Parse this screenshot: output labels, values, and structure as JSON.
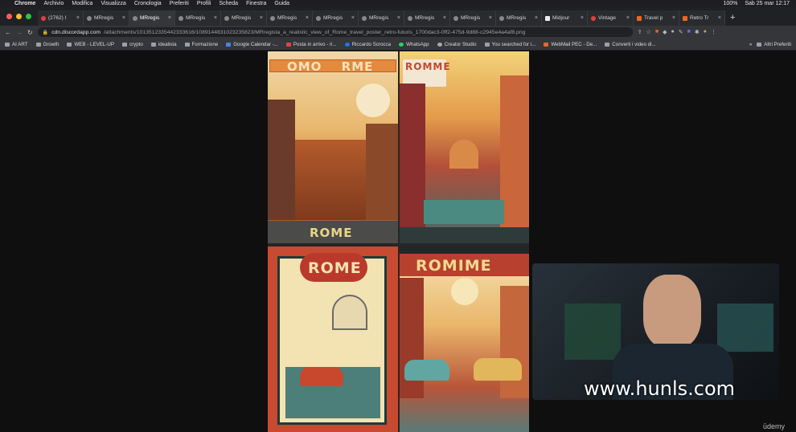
{
  "menubar": {
    "app": "Chrome",
    "items": [
      "Archivio",
      "Modifica",
      "Visualizza",
      "Cronologia",
      "Preferiti",
      "Profili",
      "Scheda",
      "Finestra",
      "Guida"
    ],
    "battery": "100%",
    "clock": "Sab 25 mar 12:17"
  },
  "tabs": [
    {
      "label": "(2762) I"
    },
    {
      "label": "MRregis"
    },
    {
      "label": "MRregis",
      "active": true
    },
    {
      "label": "MRregis"
    },
    {
      "label": "MRregis"
    },
    {
      "label": "MRregis"
    },
    {
      "label": "MRregis"
    },
    {
      "label": "MRregis"
    },
    {
      "label": "MRregis"
    },
    {
      "label": "MRregis"
    },
    {
      "label": "MRregis"
    },
    {
      "label": "Midjour"
    },
    {
      "label": "Vintage"
    },
    {
      "label": "Travel p"
    },
    {
      "label": "Retro Tr"
    }
  ],
  "address": {
    "host": "cdn.discordapp.com",
    "path": "/attachments/1013512335442333616/1089144831023235823/MRregista_a_realistic_view_of_Rome_travel_poster_retro-futuris_1700dac3-0ff2-475d-9d88-c2945e4a4af8.png"
  },
  "bookmarks": [
    "AI ART",
    "Growth",
    "WEB - LEVEL-UP",
    "crypto",
    "idealista",
    "Formazione",
    "Google Calendar -...",
    "Posta in arrivo - ri...",
    "Riccardo Scrocca",
    "WhatsApp",
    "Creator Studio",
    "You searched for i...",
    "WebMail PEC - De...",
    "Converti i video di..."
  ],
  "bookmarks_more": "»",
  "bookmarks_other": "Altri Preferiti",
  "posters": {
    "p1_top": "OMO RME",
    "p1_bottom": "ROME",
    "p2_top": "ROMME",
    "p3_top": "ROME",
    "p4_top": "ROMIME"
  },
  "watermark": "www.hunls.com",
  "udemy": "ūdemy",
  "colors": {
    "traffic_red": "#ff5f57",
    "traffic_yellow": "#febc2e",
    "traffic_green": "#28c840"
  }
}
